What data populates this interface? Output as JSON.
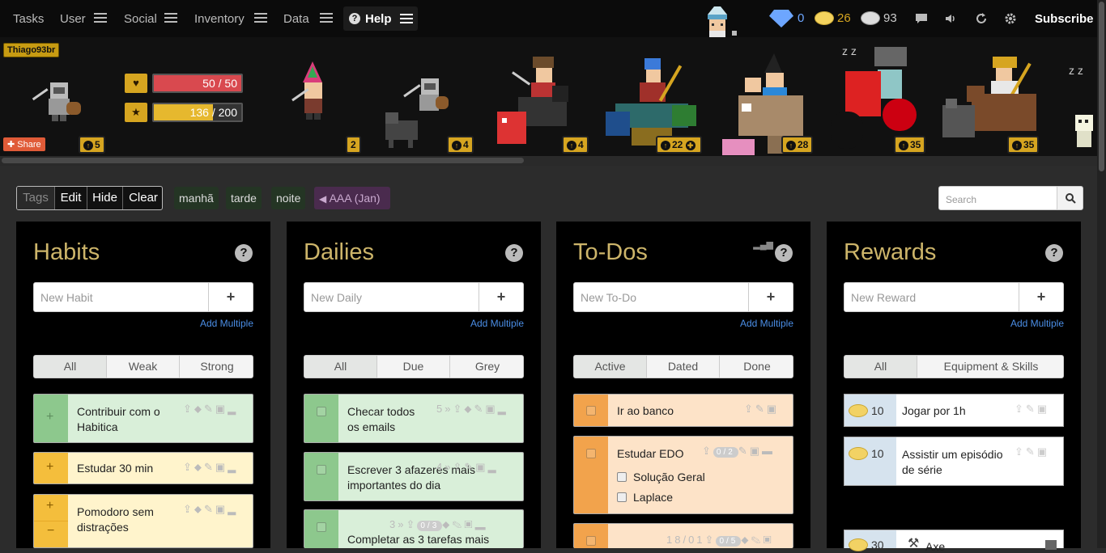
{
  "topnav": {
    "items": [
      "Tasks",
      "User",
      "Social",
      "Inventory",
      "Data"
    ],
    "help": "Help",
    "gems": "0",
    "gold": "26",
    "silver": "93",
    "subscribe": "Subscribe"
  },
  "party": {
    "username": "Thiago93br",
    "share": "Share",
    "health": "50 / 50",
    "health_fraction": 1.0,
    "xp_current": "136",
    "xp_max": " / 200",
    "xp_fraction": 0.68,
    "levels": [
      "5",
      "2",
      "4",
      "4",
      "22",
      "28",
      "35",
      "35"
    ]
  },
  "filters": {
    "tags_label": "Tags",
    "edit": "Edit",
    "hide": "Hide",
    "clear": "Clear",
    "tags": [
      "manhã",
      "tarde",
      "noite"
    ],
    "challenge_tag": "AAA (Jan)",
    "search_placeholder": "Search"
  },
  "habits": {
    "title": "Habits",
    "placeholder": "New Habit",
    "add_multiple": "Add Multiple",
    "tabs": [
      "All",
      "Weak",
      "Strong"
    ],
    "tasks": [
      {
        "text": "Contribuir com o Habitica"
      },
      {
        "text": "Estudar 30 min"
      },
      {
        "text": "Pomodoro sem distrações"
      }
    ]
  },
  "dailies": {
    "title": "Dailies",
    "placeholder": "New Daily",
    "add_multiple": "Add Multiple",
    "tabs": [
      "All",
      "Due",
      "Grey"
    ],
    "tasks": [
      {
        "text": "Checar todos os emails",
        "streak": "5"
      },
      {
        "text": "Escrever 3 afazeres mais importantes do dia",
        "streak": "4"
      },
      {
        "text": "Completar as 3 tarefas mais",
        "streak": "3",
        "checklist": "0/3"
      }
    ]
  },
  "todos": {
    "title": "To-Dos",
    "placeholder": "New To-Do",
    "add_multiple": "Add Multiple",
    "tabs": [
      "Active",
      "Dated",
      "Done"
    ],
    "tasks": [
      {
        "text": "Ir ao banco"
      },
      {
        "text": "Estudar EDO",
        "checklist": "0/2",
        "subtasks": [
          "Solução Geral",
          "Laplace"
        ]
      },
      {
        "text": "",
        "date": "18/01",
        "checklist": "0/5"
      }
    ]
  },
  "rewards": {
    "title": "Rewards",
    "placeholder": "New Reward",
    "add_multiple": "Add Multiple",
    "tabs": [
      "All",
      "Equipment & Skills"
    ],
    "items": [
      {
        "cost": "10",
        "text": "Jogar por 1h"
      },
      {
        "cost": "10",
        "text": "Assistir um episódio de série"
      },
      {
        "cost": "30",
        "text": "Axe"
      }
    ]
  },
  "colors": {
    "green": "#d9efd9",
    "green_ctl": "#8dc88d",
    "yellow": "#fff4cc",
    "yellow_ctl": "#f4be3c",
    "orange": "#fde3c8",
    "orange_ctl": "#f2a34c",
    "title_gold": "#cdb56a"
  }
}
